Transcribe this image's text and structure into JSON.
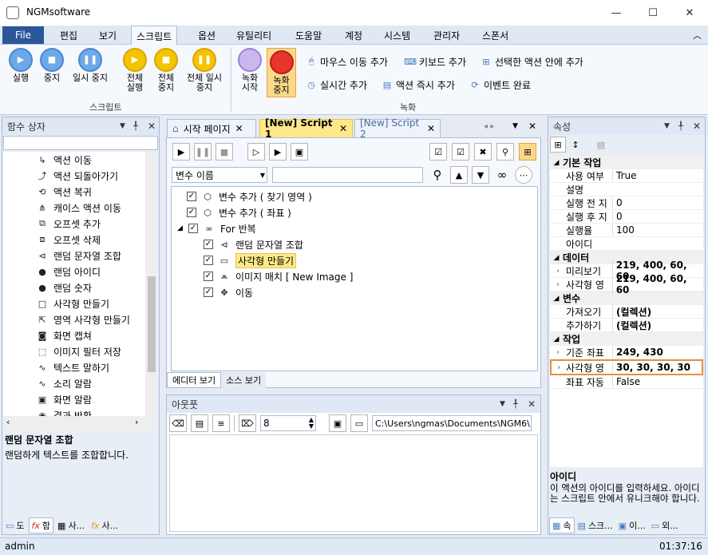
{
  "window": {
    "title": "NGMsoftware",
    "min": "—",
    "max": "☐",
    "close": "✕"
  },
  "menu": {
    "file": "File",
    "tabs": [
      "편집",
      "보기",
      "스크립트",
      "옵션",
      "유틸리티",
      "도움말",
      "계정",
      "시스템",
      "관리자",
      "스폰서"
    ],
    "collapse": "︿"
  },
  "ribbon": {
    "script_buttons": [
      {
        "label": "실행"
      },
      {
        "label": "중지"
      },
      {
        "label": "일시 중지"
      }
    ],
    "all_buttons": [
      {
        "label": "전체 실행"
      },
      {
        "label": "전체 중지"
      },
      {
        "label": "전체 일시 중지"
      }
    ],
    "script_group": "스크립트",
    "rec_buttons": [
      {
        "label": "녹화 시작"
      },
      {
        "label": "녹화 중지"
      }
    ],
    "small_buttons": [
      "마우스 이동 추가",
      "키보드 추가",
      "선택한 액션 안에 추가",
      "실시간 추가",
      "액션 즉시 추가",
      "이벤트 완료"
    ],
    "record_group": "녹화"
  },
  "left_panel": {
    "title": "함수 상자",
    "items": [
      "액션 이동",
      "액션 되돌아가기",
      "액션 복귀",
      "캐이스 액션 이동",
      "오프셋 추가",
      "오프셋 삭제",
      "랜덤 문자열 조합",
      "랜덤 아이디",
      "랜덤 숫자",
      "사각형 만들기",
      "영역 사각형 만들기",
      "화면 캡쳐",
      "이미지 필터 저장",
      "텍스트 말하기",
      "소리 알람",
      "화면 알람",
      "결과 반환"
    ],
    "desc_title": "랜덤 문자열 조합",
    "desc_text": "랜덤하게 텍스트를 조합합니다.",
    "bottom_tabs": [
      "도",
      "함",
      "사...",
      "사..."
    ]
  },
  "doc_tabs": [
    "시작 페이지",
    "[New] Script 1",
    "[New] Script 2"
  ],
  "editor": {
    "var_select": "변수 이름",
    "search_value": "",
    "tree": [
      {
        "label": "변수 추가 ( 찾기 영역 )",
        "indent": 0
      },
      {
        "label": "변수 추가 ( 좌표 )",
        "indent": 0
      },
      {
        "label": "For 반복",
        "indent": 0
      },
      {
        "label": "랜덤 문자열 조합",
        "indent": 1
      },
      {
        "label": "사각형 만들기",
        "indent": 1
      },
      {
        "label": "이미지 매치 [ New Image ]",
        "indent": 1
      },
      {
        "label": "이동",
        "indent": 1
      }
    ],
    "bottom_tabs": [
      "에디터 보기",
      "소스 보기"
    ]
  },
  "output": {
    "title": "아웃풋",
    "count": "8",
    "path": "C:\\Users\\ngmas\\Documents\\NGM6\\"
  },
  "properties": {
    "title": "속성",
    "categories": [
      {
        "name": "기본 작업",
        "rows": [
          [
            "사용 여부",
            "True"
          ],
          [
            "설명",
            ""
          ],
          [
            "실행 전 지",
            "0"
          ],
          [
            "실행 후 지",
            "0"
          ],
          [
            "실행율",
            "100"
          ],
          [
            "아이디",
            ""
          ]
        ]
      },
      {
        "name": "데이터",
        "rows": [
          [
            "미리보기",
            "219, 400, 60, 60"
          ],
          [
            "사각형 영",
            "219, 400, 60, 60"
          ]
        ]
      },
      {
        "name": "변수",
        "rows": [
          [
            "가져오기",
            "(컬렉션)"
          ],
          [
            "추가하기",
            "(컬렉션)"
          ]
        ]
      },
      {
        "name": "작업",
        "rows": [
          [
            "기준 좌표",
            "249, 430"
          ],
          [
            "사각형 영",
            "30, 30, 30, 30"
          ],
          [
            "좌표 자동",
            "False"
          ]
        ]
      }
    ],
    "desc_title": "아이디",
    "desc_text": "이 액션의 아이디를 입력하세요. 아이디는 스크립트 안에서 유니크해야 합니다.",
    "bottom_tabs": [
      "속",
      "스크...",
      "이...",
      "외..."
    ]
  },
  "status": {
    "user": "admin",
    "time": "01:37:16"
  },
  "colors": {
    "accent": "#2b579a",
    "highlight": "#e6913c",
    "selected": "#ffe88a"
  }
}
